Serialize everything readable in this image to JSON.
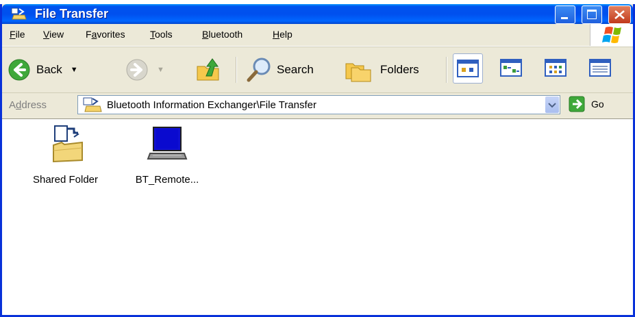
{
  "window": {
    "title": "File Transfer",
    "title_icon": "bluetooth-folder-icon"
  },
  "menu": {
    "items": [
      {
        "label_pre": "",
        "label_ul": "F",
        "label_post": "ile"
      },
      {
        "label_pre": "",
        "label_ul": "V",
        "label_post": "iew"
      },
      {
        "label_pre": "F",
        "label_ul": "a",
        "label_post": "vorites"
      },
      {
        "label_pre": "",
        "label_ul": "T",
        "label_post": "ools"
      },
      {
        "label_pre": "",
        "label_ul": "B",
        "label_post": "luetooth"
      },
      {
        "label_pre": "",
        "label_ul": "H",
        "label_post": "elp"
      }
    ]
  },
  "toolbar": {
    "back_label": "Back",
    "search_label": "Search",
    "folders_label": "Folders"
  },
  "address": {
    "label_pre": "A",
    "label_ul": "d",
    "label_post": "dress",
    "path": "Bluetooth Information Exchanger\\File Transfer",
    "go_label": "Go"
  },
  "files": [
    {
      "name": "Shared Folder",
      "icon": "shared-folder-icon"
    },
    {
      "name": "BT_Remote...",
      "icon": "laptop-icon"
    }
  ],
  "colors": {
    "titlebar": "#0054E3",
    "chrome": "#ECE9D8",
    "border": "#0831D9",
    "close": "#D9512B"
  }
}
